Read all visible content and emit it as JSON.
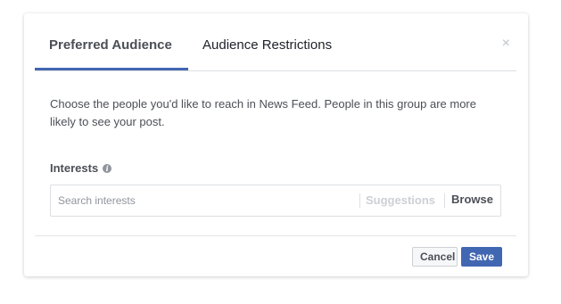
{
  "colors": {
    "accent": "#4267b2",
    "text": "#4b4f56",
    "muted": "#90949c",
    "border": "#dddfe2"
  },
  "dialog": {
    "tabs": [
      {
        "label": "Preferred Audience",
        "active": true
      },
      {
        "label": "Audience Restrictions",
        "active": false
      }
    ],
    "close_icon": "close-icon",
    "close_glyph": "×"
  },
  "body": {
    "description": "Choose the people you'd like to reach in News Feed. People in this group are more likely to see your post.",
    "interests_label": "Interests",
    "info_icon": "info-icon",
    "info_glyph": "i",
    "search": {
      "placeholder": "Search interests",
      "value": ""
    },
    "suggestions_label": "Suggestions",
    "browse_label": "Browse"
  },
  "footer": {
    "cancel_label": "Cancel",
    "save_label": "Save"
  }
}
